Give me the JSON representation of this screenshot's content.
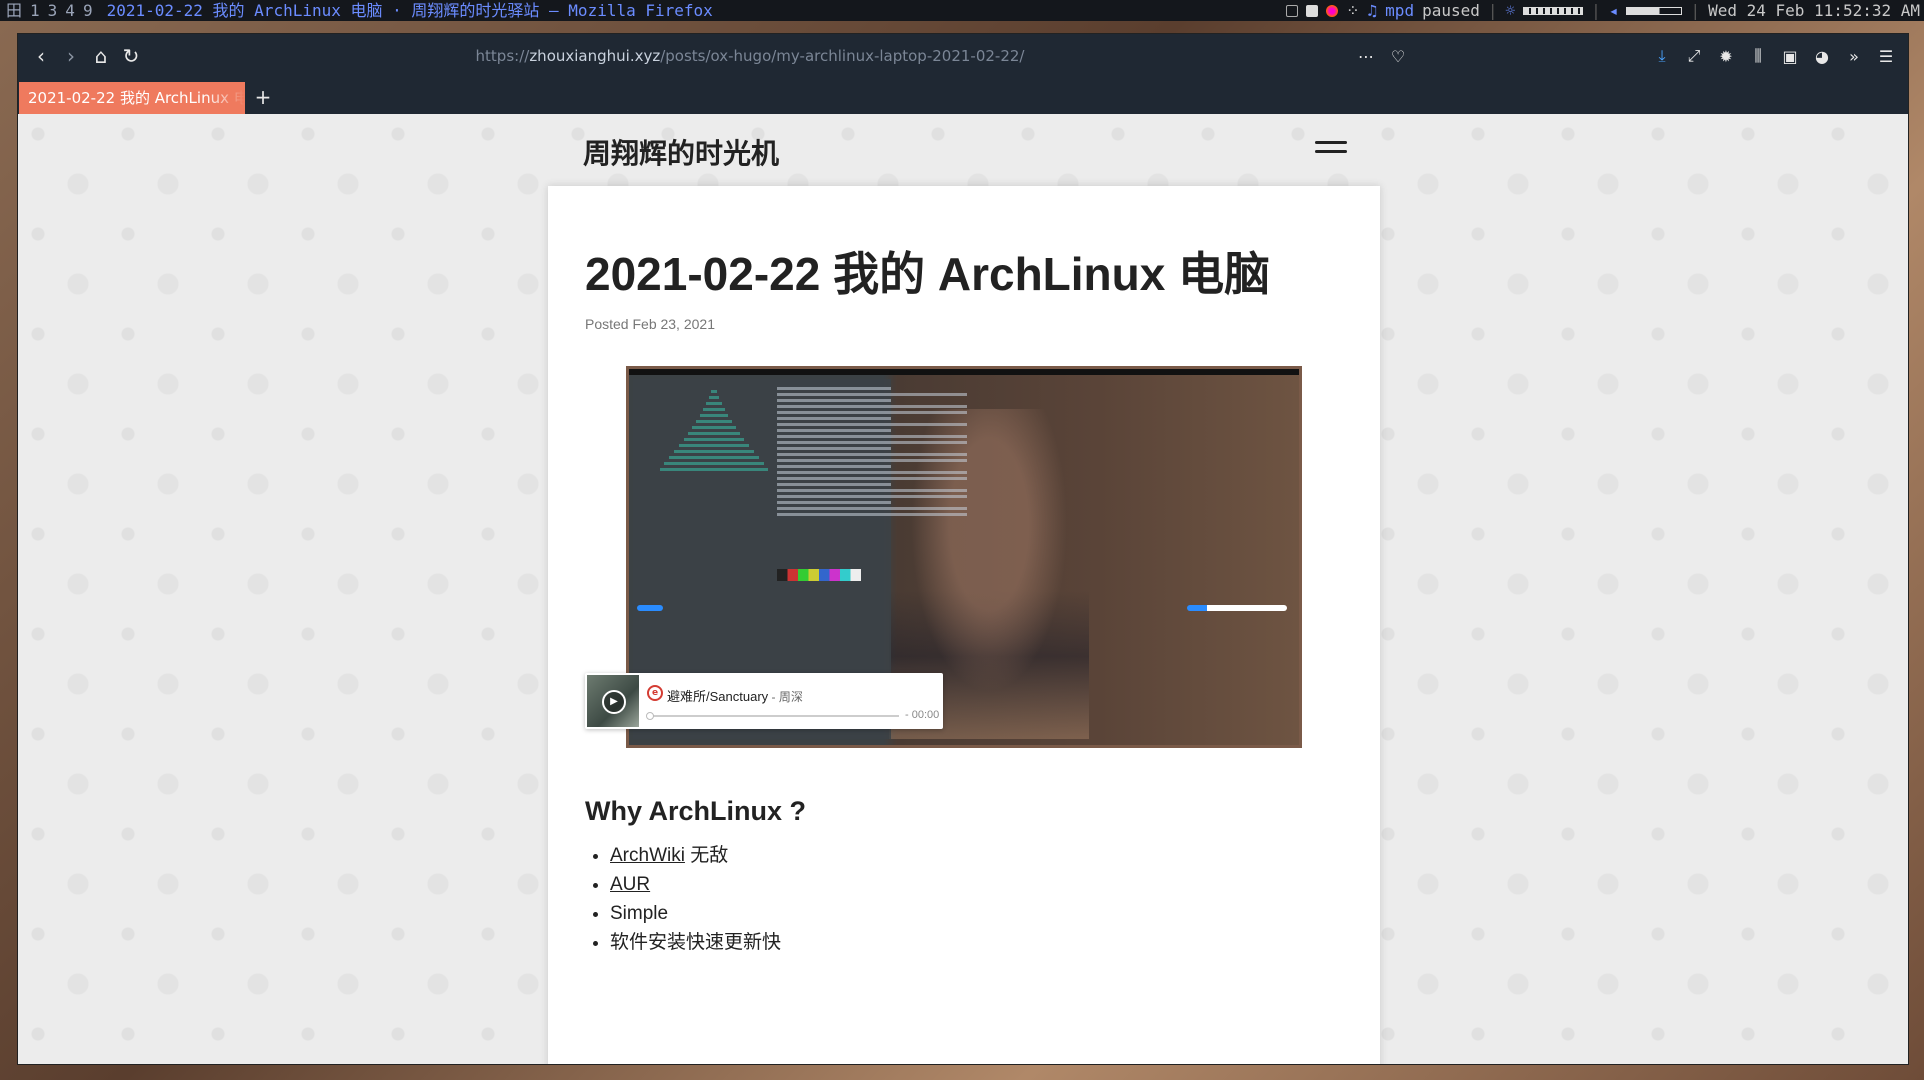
{
  "statusbar": {
    "workspace_icon": "田",
    "workspaces": [
      "1",
      "3",
      "4",
      "9"
    ],
    "window_title": "2021-02-22 我的 ArchLinux 电脑 · 周翔辉的时光驿站 — Mozilla Firefox",
    "mpd_label": "mpd",
    "mpd_state": "paused",
    "datetime": "Wed 24 Feb 11:52:32 AM"
  },
  "browser": {
    "url_prefix": "https://",
    "url_domain": "zhouxianghui.xyz",
    "url_path": "/posts/ox-hugo/my-archlinux-laptop-2021-02-22/",
    "tab_title": "2021-02-22 我的 ArchLinux 电脑",
    "new_tab": "+"
  },
  "site": {
    "title": "周翔辉的时光机"
  },
  "post": {
    "title": "2021-02-22 我的 ArchLinux 电脑",
    "meta": "Posted Feb 23, 2021"
  },
  "player": {
    "song": "避难所/Sanctuary",
    "artist_sep": " - ",
    "artist": "周深",
    "time": "- 00:00"
  },
  "section": {
    "heading": "Why ArchLinux ?",
    "items": [
      {
        "link": "ArchWiki",
        "text": " 无敌"
      },
      {
        "link": "AUR",
        "text": ""
      },
      {
        "link": "",
        "text": "Simple"
      },
      {
        "link": "",
        "text": "软件安装快速更新快"
      }
    ]
  },
  "colors": {
    "accent_tab": "#ef7a5e",
    "toolbar": "#1f2833",
    "statusbar": "#14171c",
    "title_link": "#6b8cff"
  }
}
